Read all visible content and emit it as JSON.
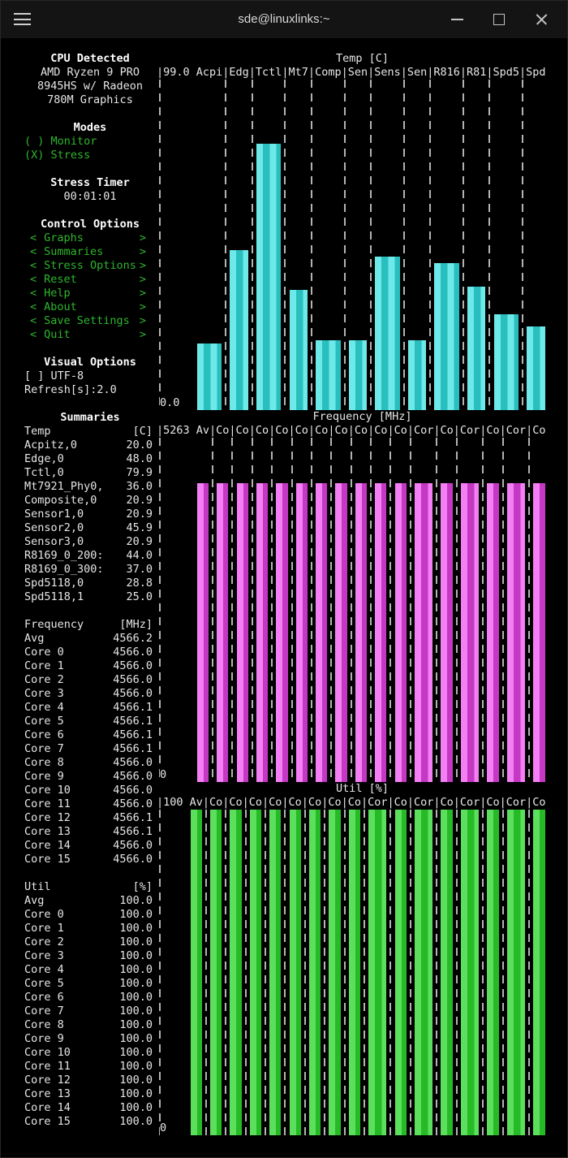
{
  "titlebar": {
    "title": "sde@linuxlinks:~",
    "icons": [
      "hamburger-icon",
      "minimize-icon",
      "maximize-icon",
      "close-icon"
    ]
  },
  "colors": {
    "menu_green": "#2eb52e",
    "grid_dash": "#b3b3b3",
    "background": "#000000",
    "text": "#e6e6e6"
  },
  "sidebar": {
    "cpu": {
      "header": "CPU Detected",
      "lines": [
        "AMD Ryzen 9 PRO",
        "8945HS w/ Radeon",
        "780M Graphics"
      ]
    },
    "modes": {
      "header": "Modes",
      "items": [
        {
          "label": "Monitor",
          "selected": false
        },
        {
          "label": "Stress",
          "selected": true
        }
      ]
    },
    "stress_timer": {
      "header": "Stress Timer",
      "value": "00:01:01"
    },
    "control": {
      "header": "Control Options",
      "items": [
        "Graphs",
        "Summaries",
        "Stress Options",
        "Reset",
        "Help",
        "About",
        "Save Settings",
        "Quit"
      ]
    },
    "visual": {
      "header": "Visual Options",
      "utf8": "[ ] UTF-8",
      "refresh": "Refresh[s]:2.0"
    },
    "summaries": {
      "header": "Summaries",
      "groups": [
        {
          "title": "Temp",
          "unit": "[C]",
          "rows": [
            [
              "Acpitz,0",
              "20.0"
            ],
            [
              "Edge,0",
              "48.0"
            ],
            [
              "Tctl,0",
              "79.9"
            ],
            [
              "Mt7921_Phy0,",
              "36.0"
            ],
            [
              "Composite,0",
              "20.9"
            ],
            [
              "Sensor1,0",
              "20.9"
            ],
            [
              "Sensor2,0",
              "45.9"
            ],
            [
              "Sensor3,0",
              "20.9"
            ],
            [
              "R8169_0_200:",
              "44.0"
            ],
            [
              "R8169_0_300:",
              "37.0"
            ],
            [
              "Spd5118,0",
              "28.8"
            ],
            [
              "Spd5118,1",
              "25.0"
            ]
          ]
        },
        {
          "title": "Frequency",
          "unit": "[MHz]",
          "rows": [
            [
              "Avg",
              "4566.2"
            ],
            [
              "Core 0",
              "4566.0"
            ],
            [
              "Core 1",
              "4566.0"
            ],
            [
              "Core 2",
              "4566.0"
            ],
            [
              "Core 3",
              "4566.0"
            ],
            [
              "Core 4",
              "4566.1"
            ],
            [
              "Core 5",
              "4566.1"
            ],
            [
              "Core 6",
              "4566.1"
            ],
            [
              "Core 7",
              "4566.1"
            ],
            [
              "Core 8",
              "4566.0"
            ],
            [
              "Core 9",
              "4566.0"
            ],
            [
              "Core 10",
              "4566.0"
            ],
            [
              "Core 11",
              "4566.0"
            ],
            [
              "Core 12",
              "4566.1"
            ],
            [
              "Core 13",
              "4566.1"
            ],
            [
              "Core 14",
              "4566.0"
            ],
            [
              "Core 15",
              "4566.0"
            ]
          ]
        },
        {
          "title": "Util",
          "unit": "[%]",
          "rows": [
            [
              "Avg",
              "100.0"
            ],
            [
              "Core 0",
              "100.0"
            ],
            [
              "Core 1",
              "100.0"
            ],
            [
              "Core 2",
              "100.0"
            ],
            [
              "Core 3",
              "100.0"
            ],
            [
              "Core 4",
              "100.0"
            ],
            [
              "Core 5",
              "100.0"
            ],
            [
              "Core 6",
              "100.0"
            ],
            [
              "Core 7",
              "100.0"
            ],
            [
              "Core 8",
              "100.0"
            ],
            [
              "Core 9",
              "100.0"
            ],
            [
              "Core 10",
              "100.0"
            ],
            [
              "Core 11",
              "100.0"
            ],
            [
              "Core 12",
              "100.0"
            ],
            [
              "Core 13",
              "100.0"
            ],
            [
              "Core 14",
              "100.0"
            ],
            [
              "Core 15",
              "100.0"
            ]
          ]
        }
      ]
    }
  },
  "chart_data": [
    {
      "type": "bar",
      "name": "temp",
      "title": "Temp [C]",
      "header": "|99.0 Acpi|Edg|Tctl|Mt7|Comp|Sen|Sens|Sen|R816|R81|Spd5|Spd",
      "ymax_label": "99.0",
      "ymin_label": "0.0",
      "ylim": [
        0,
        99.0
      ],
      "grid": "dashed-vertical",
      "categories": [
        "Acpitz",
        "Edge",
        "Tctl",
        "Mt7921_Phy0",
        "Composite",
        "Sensor1",
        "Sensor2",
        "Sensor3",
        "R8169_0_200",
        "R8169_0_300",
        "Spd5118_0",
        "Spd5118_1"
      ],
      "values": [
        20.0,
        48.0,
        79.9,
        36.0,
        20.9,
        20.9,
        45.9,
        20.9,
        44.0,
        37.0,
        28.8,
        25.0
      ],
      "bar_bright": "#6ee9e9",
      "bar_dark": "#29bfbf"
    },
    {
      "type": "bar",
      "name": "frequency",
      "title": "Frequency [MHz]",
      "header": "|5263 Av|Co|Co|Co|Co|Co|Co|Co|Co|Co|Co|Cor|Co|Cor|Co|Cor|Co",
      "ymax_label": "5263",
      "ymin_label": "0",
      "ylim": [
        0,
        5263
      ],
      "grid": "dashed-vertical",
      "categories": [
        "Avg",
        "Core 0",
        "Core 1",
        "Core 2",
        "Core 3",
        "Core 4",
        "Core 5",
        "Core 6",
        "Core 7",
        "Core 8",
        "Core 9",
        "Core 10",
        "Core 11",
        "Core 12",
        "Core 13",
        "Core 14",
        "Core 15"
      ],
      "values": [
        4566.2,
        4566.0,
        4566.0,
        4566.0,
        4566.0,
        4566.1,
        4566.1,
        4566.1,
        4566.1,
        4566.0,
        4566.0,
        4566.0,
        4566.0,
        4566.1,
        4566.1,
        4566.0,
        4566.0
      ],
      "bar_bright": "#f47ef4",
      "bar_dark": "#c438c4"
    },
    {
      "type": "bar",
      "name": "util",
      "title": "Util [%]",
      "header": "|100 Av|Co|Co|Co|Co|Co|Co|Co|Co|Cor|Co|Cor|Co|Cor|Co|Cor|Co",
      "ymax_label": "100",
      "ymin_label": "0",
      "ylim": [
        0,
        100
      ],
      "grid": "dashed-vertical",
      "categories": [
        "Avg",
        "Core 0",
        "Core 1",
        "Core 2",
        "Core 3",
        "Core 4",
        "Core 5",
        "Core 6",
        "Core 7",
        "Core 8",
        "Core 9",
        "Core 10",
        "Core 11",
        "Core 12",
        "Core 13",
        "Core 14",
        "Core 15"
      ],
      "values": [
        100.0,
        100.0,
        100.0,
        100.0,
        100.0,
        100.0,
        100.0,
        100.0,
        100.0,
        100.0,
        100.0,
        100.0,
        100.0,
        100.0,
        100.0,
        100.0,
        100.0
      ],
      "bar_bright": "#5cdf5c",
      "bar_dark": "#26bb26"
    }
  ]
}
